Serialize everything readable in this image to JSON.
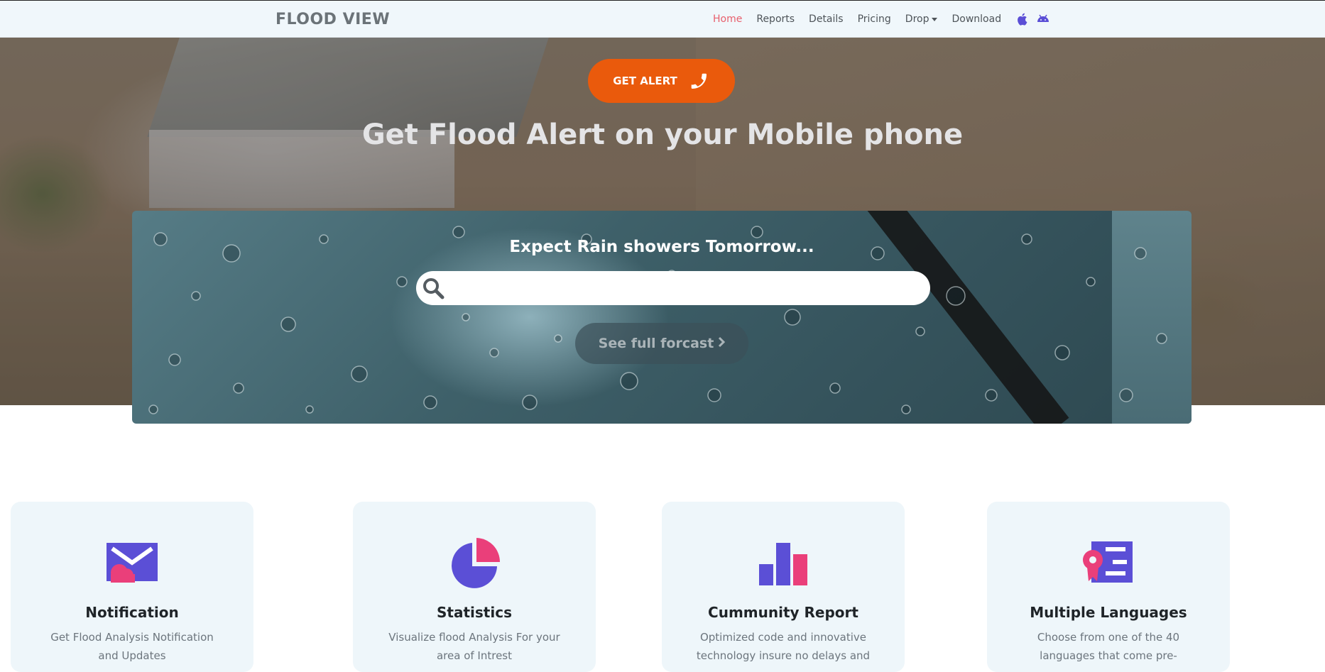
{
  "nav": {
    "brand": "FLOOD VIEW",
    "links": [
      "Home",
      "Reports",
      "Details",
      "Pricing",
      "Drop",
      "Download"
    ],
    "active": "Home",
    "icons": [
      "apple-icon",
      "android-icon"
    ],
    "accent": "#5b4fd6"
  },
  "hero": {
    "alert_label": "GET ALERT",
    "title": "Get Flood Alert on your Mobile phone",
    "alert_color": "#ea5a0c"
  },
  "rain": {
    "title": "Expect Rain showers Tomorrow...",
    "search_value": "",
    "forecast_label": "See full forcast"
  },
  "features": [
    {
      "icon": "mail-icon",
      "title": "Notification",
      "desc": "Get Flood Analysis Notification and Updates"
    },
    {
      "icon": "pie-chart-icon",
      "title": "Statistics",
      "desc": "Visualize flood Analysis For your area of Intrest"
    },
    {
      "icon": "bar-chart-icon",
      "title": "Cummunity Report",
      "desc": "Optimized code and innovative technology insure no delays and"
    },
    {
      "icon": "language-icon",
      "title": "Multiple Languages",
      "desc": "Choose from one of the 40 languages that come pre-"
    }
  ],
  "colors": {
    "icon_primary": "#5b4fd6",
    "icon_secondary": "#ea3f7a"
  }
}
